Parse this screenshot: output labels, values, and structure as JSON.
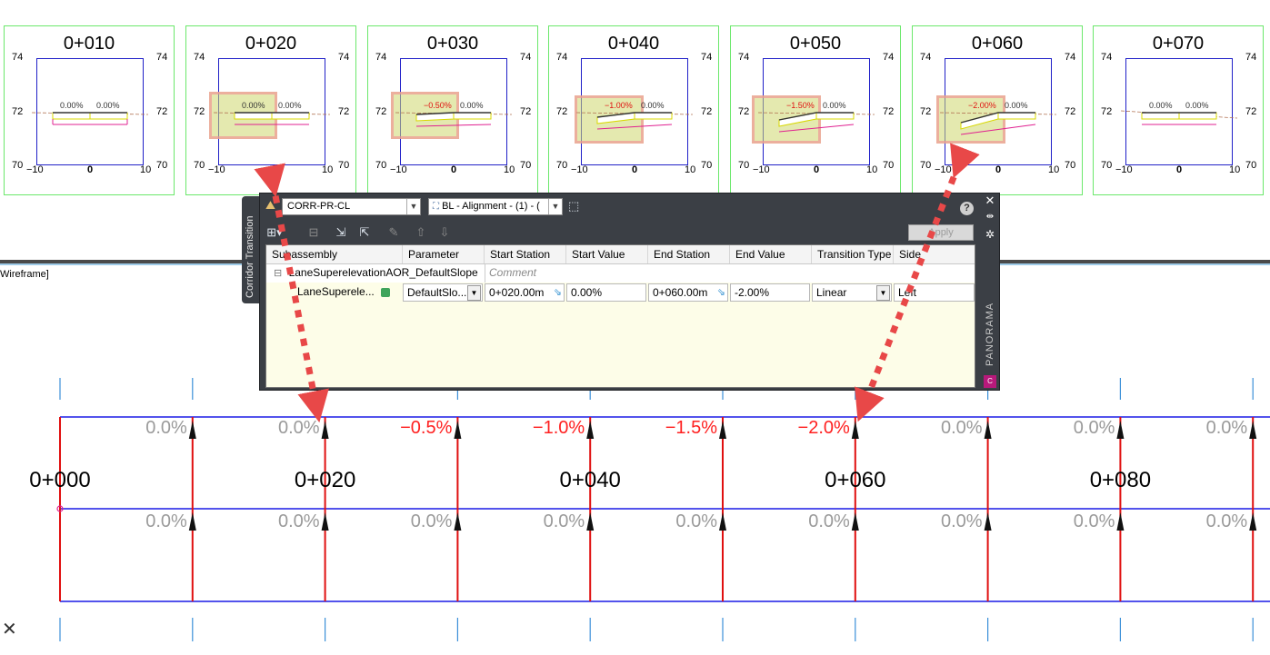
{
  "sections": [
    {
      "station": "0+010",
      "left_slope": "0.00%",
      "right_slope": "0.00%",
      "highlighted": false,
      "tilt": 0
    },
    {
      "station": "0+020",
      "left_slope": "0.00%",
      "right_slope": "0.00%",
      "highlighted": true,
      "tilt": 0
    },
    {
      "station": "0+030",
      "left_slope": "−0.50%",
      "right_slope": "0.00%",
      "highlighted": true,
      "tilt": -0.5
    },
    {
      "station": "0+040",
      "left_slope": "−1.00%",
      "right_slope": "0.00%",
      "highlighted": true,
      "tilt": -1.0
    },
    {
      "station": "0+050",
      "left_slope": "−1.50%",
      "right_slope": "0.00%",
      "highlighted": true,
      "tilt": -1.5
    },
    {
      "station": "0+060",
      "left_slope": "−2.00%",
      "right_slope": "0.00%",
      "highlighted": true,
      "tilt": -2.0
    },
    {
      "station": "0+070",
      "left_slope": "0.00%",
      "right_slope": "0.00%",
      "highlighted": false,
      "tilt": 0
    }
  ],
  "section_axis": {
    "y_top": "74",
    "y_mid": "72",
    "y_bot": "70",
    "x_left": "−10",
    "x_mid": "0",
    "x_right": "10"
  },
  "viewport_label": "Wireframe]",
  "plan": {
    "stations": [
      "0+000",
      "0+020",
      "0+040",
      "0+060",
      "0+080"
    ],
    "top_pct": [
      "0.0%",
      "0.0%",
      "−0.5%",
      "−1.0%",
      "−1.5%",
      "−2.0%",
      "0.0%",
      "0.0%",
      "0.0%"
    ],
    "top_pct_red": [
      false,
      false,
      true,
      true,
      true,
      true,
      false,
      false,
      false
    ],
    "bottom_pct": [
      "0.0%",
      "0.0%",
      "0.0%",
      "0.0%",
      "0.0%",
      "0.0%",
      "0.0%",
      "0.0%",
      "0.0%"
    ]
  },
  "panorama": {
    "side_tab": "Corridor Transition",
    "corridor_combo": "CORR-PR-CL",
    "baseline_combo": "BL - Alignment - (1) - (",
    "apply_label": "Apply",
    "vertical_title": "PANORAMA",
    "logo": "C",
    "columns": [
      "Subassembly",
      "Parameter",
      "Start Station",
      "Start Value",
      "End Station",
      "End Value",
      "Transition Type",
      "Side"
    ],
    "group_row": {
      "name": "LaneSuperelevationAOR_DefaultSlope",
      "comment": "Comment"
    },
    "data_row": {
      "subassembly": "LaneSuperele...",
      "parameter": "DefaultSlo...",
      "start_station": "0+020.00m",
      "start_value": "0.00%",
      "end_station": "0+060.00m",
      "end_value": "-2.00%",
      "transition_type": "Linear",
      "side": "Left"
    }
  },
  "colors": {
    "section_frame": "#6be86b",
    "section_box": "#2020c8",
    "plan_blue": "#1a1ae6",
    "plan_red": "#e01010",
    "slope_red": "#ff2020",
    "arrow_red": "#e84848"
  }
}
